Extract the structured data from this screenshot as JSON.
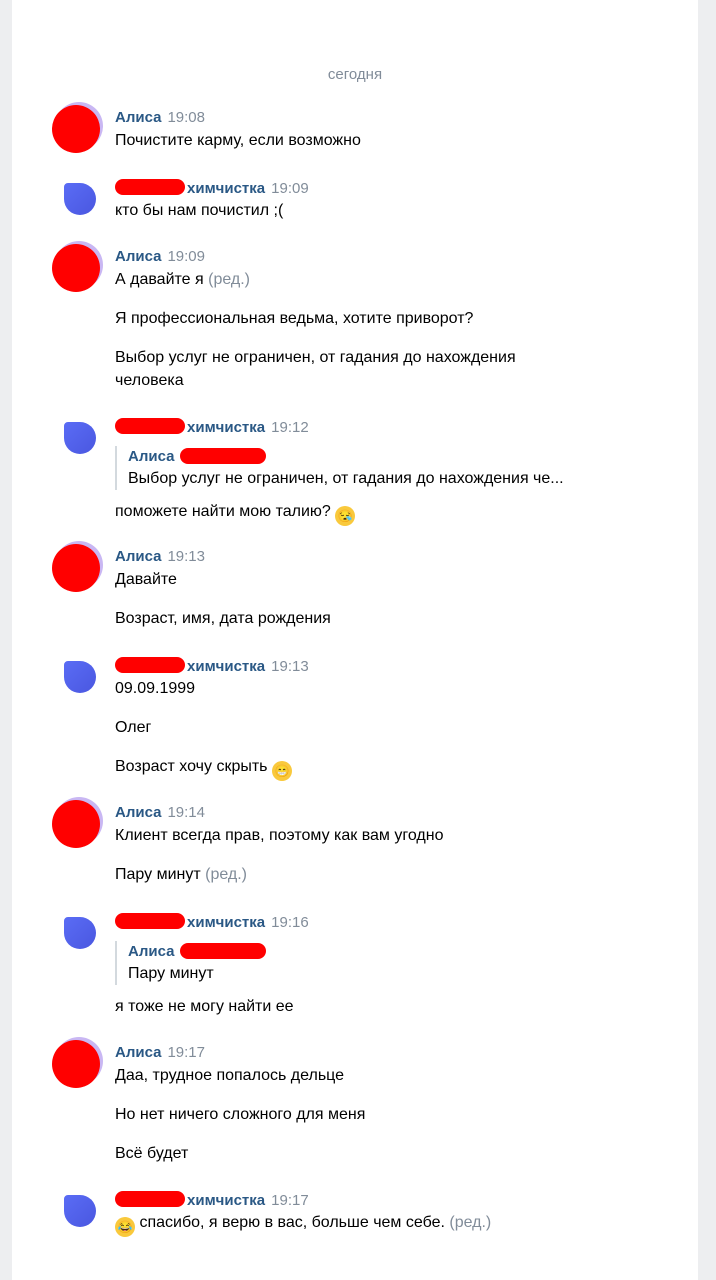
{
  "date_separator": "сегодня",
  "colors": {
    "author": "#2a5885",
    "meta": "#818c99",
    "redaction": "#ff0000"
  },
  "messages": [
    {
      "author": "Алиса",
      "time": "19:08",
      "lines": [
        "Почистите карму, если возможно"
      ]
    },
    {
      "author": "химчистка",
      "time": "19:09",
      "lines": [
        "кто бы нам почистил ;("
      ]
    },
    {
      "author": "Алиса",
      "time": "19:09",
      "lines": [
        "А давайте я",
        "Я профессиональная ведьма, хотите приворот?",
        "Выбор услуг не ограничен, от гадания до нахождения",
        "человека"
      ],
      "edited": "(ред.)"
    },
    {
      "author": "химчистка",
      "time": "19:12",
      "quote": {
        "author": "Алиса",
        "text": "Выбор услуг не ограничен, от гадания до нахождения че..."
      },
      "lines": [
        "поможете найти мою талию?"
      ],
      "emoji": "sleepy-face"
    },
    {
      "author": "Алиса",
      "time": "19:13",
      "lines": [
        "Давайте",
        "Возраст, имя, дата рождения"
      ]
    },
    {
      "author": "химчистка",
      "time": "19:13",
      "lines": [
        "09.09.1999",
        "Олег",
        "Возраст хочу скрыть"
      ],
      "emoji": "grinning-face"
    },
    {
      "author": "Алиса",
      "time": "19:14",
      "lines": [
        "Клиент всегда прав, поэтому как вам угодно",
        "Пару минут"
      ],
      "edited": "(ред.)"
    },
    {
      "author": "химчистка",
      "time": "19:16",
      "quote": {
        "author": "Алиса",
        "text": "Пару минут"
      },
      "lines": [
        "я тоже не могу найти ее"
      ]
    },
    {
      "author": "Алиса",
      "time": "19:17",
      "lines": [
        "Даа, трудное попалось дельце",
        "Но нет ничего сложного для меня",
        "Всё будет"
      ]
    },
    {
      "author": "химчистка",
      "time": "19:17",
      "lines": [
        "спасибо, я верю в вас, больше чем себе."
      ],
      "edited": "(ред.)",
      "emoji": "tears-of-joy-face"
    }
  ]
}
